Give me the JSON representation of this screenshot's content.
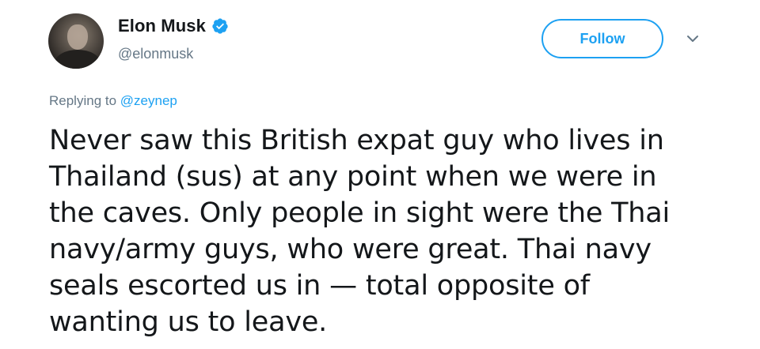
{
  "user": {
    "display_name": "Elon Musk",
    "handle": "@elonmusk",
    "verified": true,
    "avatar_icon": "profile-photo"
  },
  "actions": {
    "follow_label": "Follow",
    "menu_icon": "chevron-down-icon"
  },
  "reply": {
    "prefix": "Replying to",
    "mention": "@zeynep"
  },
  "tweet": {
    "lines": [
      "Never saw this British expat guy who lives in",
      "Thailand (sus) at any point when we were in",
      "the caves. Only people in sight were the Thai",
      "navy/army guys, who were great. Thai navy",
      "seals escorted us in — total opposite of",
      "wanting us to leave."
    ]
  },
  "colors": {
    "accent": "#1da1f2",
    "secondary_text": "#657786",
    "primary_text": "#14171a"
  }
}
